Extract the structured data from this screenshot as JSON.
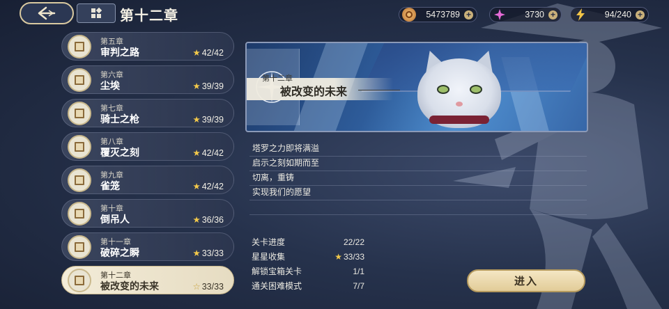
{
  "header": {
    "title": "第十二章",
    "back_icon": "back-arrow-icon",
    "home_icon": "grid-home-icon"
  },
  "resources": [
    {
      "icon": "coin-icon",
      "value": "5473789",
      "color": "#e0a050"
    },
    {
      "icon": "gem-icon",
      "value": "3730",
      "color": "#e060d0"
    },
    {
      "icon": "lightning-icon",
      "value": "94/240",
      "color": "#f0c040"
    }
  ],
  "chapters": [
    {
      "num": "第五章",
      "name": "审判之路",
      "stars": "42/42"
    },
    {
      "num": "第六章",
      "name": "尘埃",
      "stars": "39/39"
    },
    {
      "num": "第七章",
      "name": "骑士之枪",
      "stars": "39/39"
    },
    {
      "num": "第八章",
      "name": "覆灭之刻",
      "stars": "42/42"
    },
    {
      "num": "第九章",
      "name": "雀笼",
      "stars": "42/42"
    },
    {
      "num": "第十章",
      "name": "倒吊人",
      "stars": "36/36"
    },
    {
      "num": "第十一章",
      "name": "破碎之瞬",
      "stars": "33/33"
    },
    {
      "num": "第十二章",
      "name": "被改变的未来",
      "stars": "33/33",
      "active": true
    }
  ],
  "banner": {
    "chapter_label": "第十二章",
    "chapter_title": "被改变的未来"
  },
  "description": [
    "塔罗之力即将满溢",
    "启示之刻如期而至",
    "切离，重铸",
    "实现我们的愿望",
    ""
  ],
  "stats": [
    {
      "label": "关卡进度",
      "value": "22/22"
    },
    {
      "label": "星星收集",
      "value": "33/33",
      "star": true
    },
    {
      "label": "解锁宝箱关卡",
      "value": "1/1"
    },
    {
      "label": "通关困难模式",
      "value": "7/7"
    }
  ],
  "enter_label": "进入"
}
